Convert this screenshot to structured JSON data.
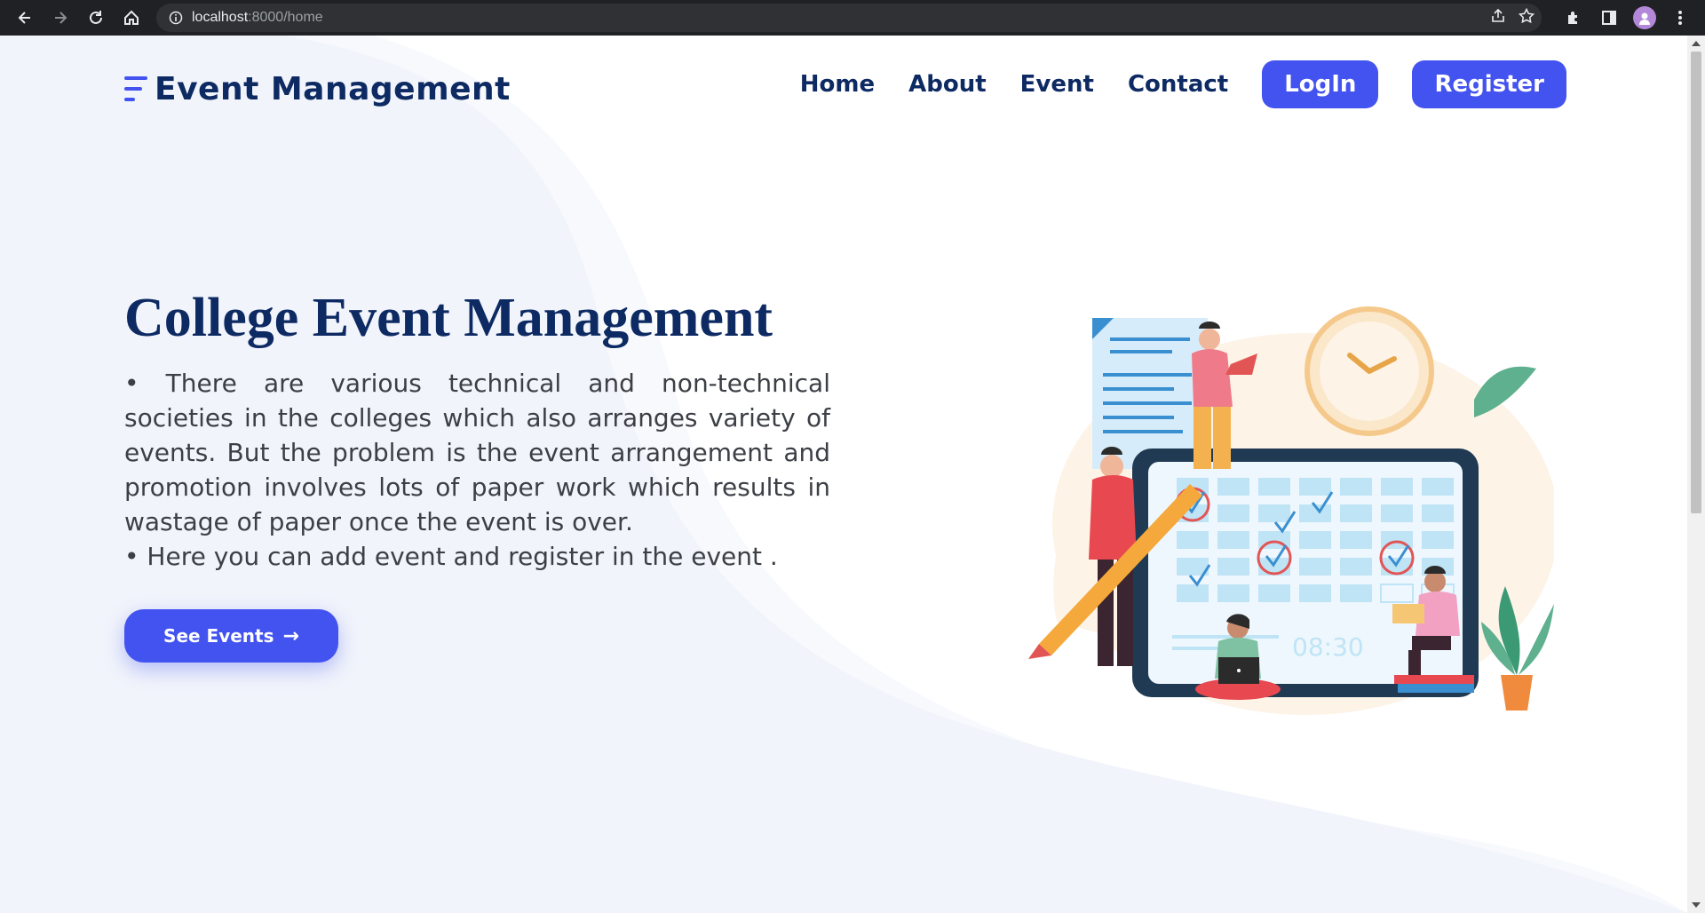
{
  "browser": {
    "url_host": "localhost",
    "url_path": ":8000/home",
    "icons": [
      "back-icon",
      "forward-icon",
      "reload-icon",
      "home-icon",
      "info-icon",
      "share-icon",
      "bookmark-star-icon",
      "extensions-icon",
      "side-panel-icon",
      "profile-avatar",
      "menu-dots-icon"
    ]
  },
  "header": {
    "logo_text": "Event Management",
    "nav": [
      "Home",
      "About",
      "Event",
      "Contact"
    ],
    "login_label": "LogIn",
    "register_label": "Register"
  },
  "hero": {
    "title": "College Event Management",
    "paragraph_1": "• There are various technical and non-technical societies in the colleges which also arranges variety of events. But the problem is the event arrangement and promotion involves lots of paper work which results in wastage of paper once the event is over.",
    "paragraph_2": "• Here you can add event and register in the event .",
    "cta_label": "See Events",
    "cta_arrow": "→"
  },
  "illustration": {
    "clock_text": "08:30"
  },
  "colors": {
    "brand_navy": "#0e2a63",
    "accent_blue": "#4353f0",
    "background_wave": "#f1f4fb"
  }
}
